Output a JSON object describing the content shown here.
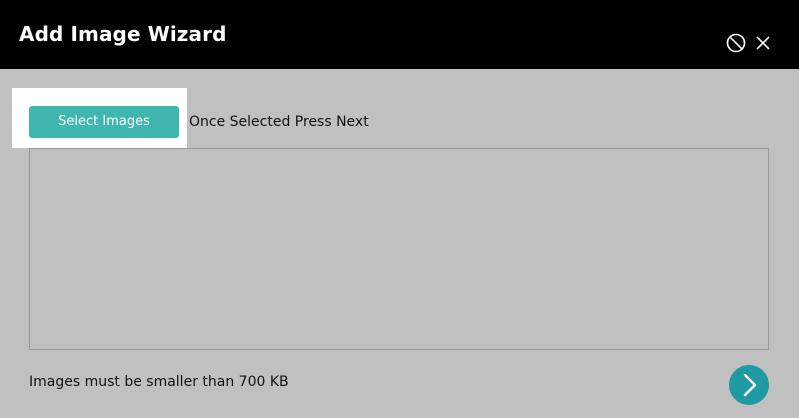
{
  "dialog": {
    "title": "Add Image Wizard"
  },
  "header_icons": {
    "cancel": "cancel-circle-icon",
    "close": "close-x-icon"
  },
  "content": {
    "select_button_label": "Select Images",
    "instruction_text": "Once Selected Press Next",
    "size_note": "Images must be smaller than 700 KB",
    "next_icon": "chevron-right-icon"
  },
  "colors": {
    "header_bg": "#000000",
    "body_bg": "#c0c0c0",
    "select_button_bg": "#3fb6ae",
    "next_button_bg": "#1f9aa2"
  }
}
